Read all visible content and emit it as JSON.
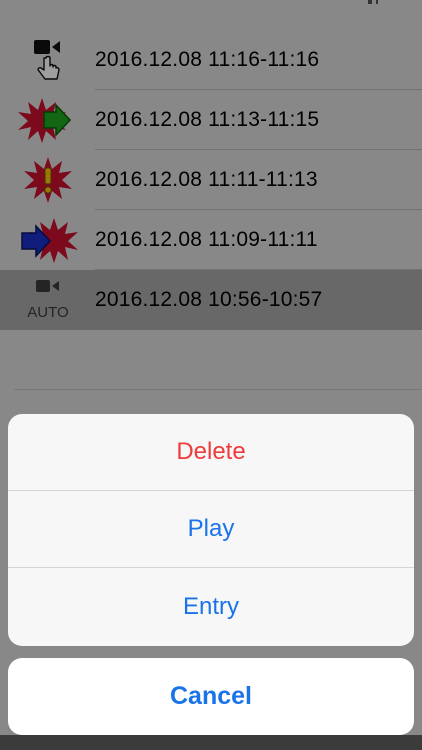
{
  "recordings": [
    {
      "label": "2016.12.08 11:16-11:16",
      "icon": "manual-record-icon",
      "selected": false
    },
    {
      "label": "2016.12.08 11:13-11:15",
      "icon": "impact-green-arrow-icon",
      "selected": false
    },
    {
      "label": "2016.12.08 11:11-11:13",
      "icon": "impact-warning-icon",
      "selected": false
    },
    {
      "label": "2016.12.08 11:09-11:11",
      "icon": "impact-blue-arrow-icon",
      "selected": false
    },
    {
      "label": "2016.12.08 10:56-10:57",
      "icon": "auto-record-icon",
      "selected": true
    }
  ],
  "auto_text": "AUTO",
  "action_sheet": {
    "delete_label": "Delete",
    "play_label": "Play",
    "entry_label": "Entry",
    "cancel_label": "Cancel"
  },
  "colors": {
    "accent": "#1a73e8",
    "destructive": "#ee3b3b",
    "burst": "#c8102e",
    "green_arrow": "#1fa51f",
    "blue_arrow": "#1b2fc9",
    "warning": "#f4c20d"
  }
}
